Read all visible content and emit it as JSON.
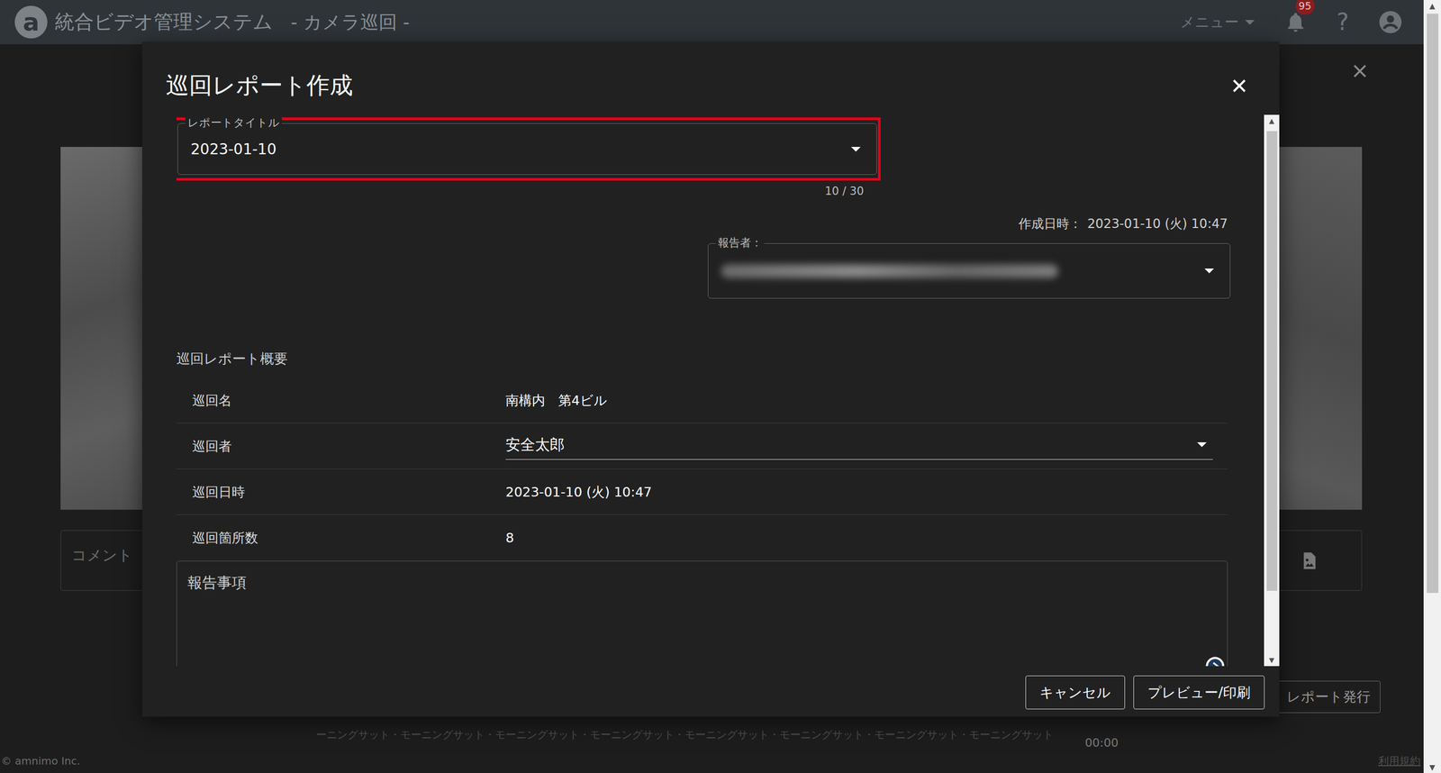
{
  "app_bar": {
    "logo": "a",
    "title": "統合ビデオ管理システム",
    "subtitle": "- カメラ巡回 -",
    "menu": "メニュー",
    "notifications": "95",
    "help": "?"
  },
  "page": {
    "comment_placeholder": "コメント",
    "issue_button": "レポート発行",
    "ticker": "ーニングサット・モーニングサット・モーニングサット・モーニングサット・モーニングサット・モーニングサット・モーニングサット・モーニングサット",
    "time": "00:00",
    "copyright": "© amnimo Inc.",
    "terms": "利用規約"
  },
  "browser_scrollbar": {
    "up": "▲",
    "down": "▼"
  },
  "dialog": {
    "title": "巡回レポート作成",
    "report_title": {
      "label": "レポートタイトル",
      "value": "2023-01-10",
      "counter": "10 / 30",
      "highlighted": true
    },
    "created": {
      "label": "作成日時：",
      "value": "2023-01-10 (火) 10:47"
    },
    "reporter": {
      "label": "報告者：",
      "blurred": true,
      "highlighted": true
    },
    "summary": {
      "title": "巡回レポート概要",
      "rows": [
        {
          "label": "巡回名",
          "value": "南構内　第4ビル",
          "kind": "text"
        },
        {
          "label": "巡回者",
          "value": "安全太郎",
          "kind": "select"
        },
        {
          "label": "巡回日時",
          "value": "2023-01-10 (火) 10:47",
          "kind": "text"
        },
        {
          "label": "巡回箇所数",
          "value": "8",
          "kind": "text"
        }
      ]
    },
    "notes": {
      "label": "報告事項"
    },
    "scrollbar": {
      "up": "▲",
      "down": "▼"
    },
    "buttons": [
      {
        "label": "キャンセル"
      },
      {
        "label": "プレビュー/印刷"
      }
    ]
  }
}
